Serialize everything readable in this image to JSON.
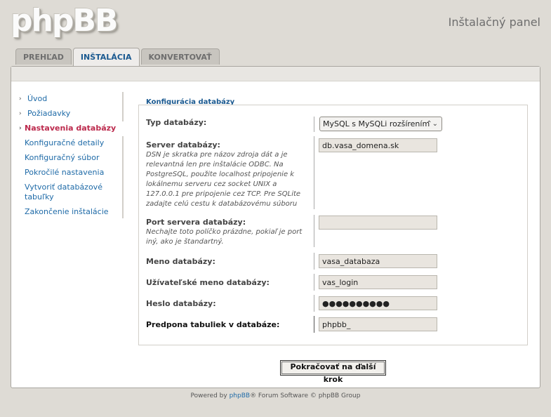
{
  "header": {
    "logo_text": "phpBB",
    "panel_title": "Inštalačný panel"
  },
  "tabs": [
    {
      "label": "PREHĽAD"
    },
    {
      "label": "INŠTALÁCIA",
      "active": true
    },
    {
      "label": "KONVERTOVAŤ"
    }
  ],
  "sidebar": {
    "items": [
      {
        "label": "Úvod"
      },
      {
        "label": "Požiadavky"
      },
      {
        "label": "Nastavenia databázy",
        "active": true
      },
      {
        "label": "Konfiguračné detaily"
      },
      {
        "label": "Konfiguračný súbor"
      },
      {
        "label": "Pokročilé nastavenia"
      },
      {
        "label": "Vytvoriť databázové tabuľky"
      },
      {
        "label": "Zakončenie inštalácie"
      }
    ]
  },
  "form": {
    "section_title": "Konfigurácia databázy",
    "db_type": {
      "label": "Typ databázy:",
      "value": "MySQL s MySQLi rozšírením"
    },
    "server": {
      "label": "Server databázy:",
      "description": "DSN je skratka pre názov zdroja dát a je relevantná len pre inštalácie ODBC. Na PostgreSQL, použite localhost pripojenie k lokálnemu serveru cez socket UNIX a 127.0.0.1 pre pripojenie cez TCP. Pre SQLite zadajte celú cestu k databázovému súboru",
      "value": "db.vasa_domena.sk"
    },
    "port": {
      "label": "Port servera databázy:",
      "description": "Nechajte toto políčko prázdne, pokiaľ je port iný, ako je štandartný.",
      "value": ""
    },
    "db_name": {
      "label": "Meno databázy:",
      "value": "vasa_databaza"
    },
    "db_user": {
      "label": "Užívateľské meno databázy:",
      "value": "vas_login"
    },
    "db_pass": {
      "label": "Heslo databázy:",
      "value": "●●●●●●●●●●"
    },
    "prefix": {
      "label": "Predpona tabuliek v databáze:",
      "value": "phpbb_"
    },
    "submit_label": "Pokračovať na ďalší krok"
  },
  "footer": {
    "powered": "Powered by",
    "brand": "phpBB",
    "rest": "® Forum Software © phpBB Group"
  }
}
